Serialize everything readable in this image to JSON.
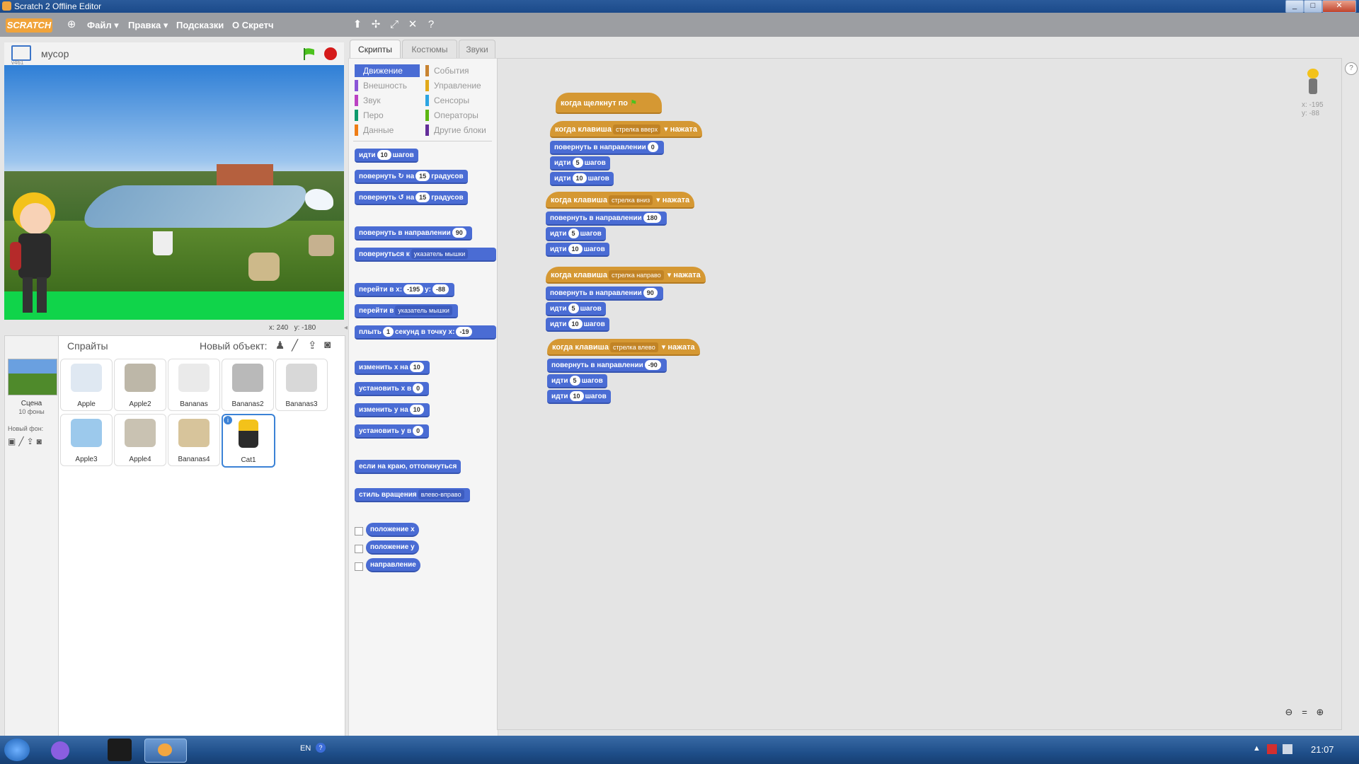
{
  "window": {
    "title": "Scratch 2 Offline Editor",
    "min": "_",
    "max": "□",
    "close": "✕"
  },
  "menubar": {
    "logo": "SCRATCH",
    "items": [
      "Файл ▾",
      "Правка ▾",
      "Подсказки",
      "О Скретч"
    ]
  },
  "stage": {
    "project_name": "мусор",
    "version": "v461",
    "coords": {
      "x_label": "x:",
      "x": "240",
      "y_label": "y:",
      "y": "-180"
    }
  },
  "sprites_pane": {
    "title": "Спрайты",
    "new_object": "Новый объект:",
    "scene_label": "Сцена",
    "scene_count": "10 фоны",
    "new_backdrop": "Новый фон:",
    "sprites": [
      "Apple",
      "Apple2",
      "Bananas",
      "Bananas2",
      "Bananas3",
      "Apple3",
      "Apple4",
      "Bananas4",
      "Cat1"
    ]
  },
  "tabs": [
    "Скрипты",
    "Костюмы",
    "Звуки"
  ],
  "categories": {
    "left": [
      "Движение",
      "Внешность",
      "Звук",
      "Перо",
      "Данные"
    ],
    "right": [
      "События",
      "Управление",
      "Сенсоры",
      "Операторы",
      "Другие блоки"
    ],
    "colors": {
      "Движение": "#4a6cd4",
      "Внешность": "#8a55d7",
      "Звук": "#bb42c3",
      "Перо": "#0e9a6c",
      "Данные": "#ee7d16",
      "События": "#c88330",
      "Управление": "#e1a91a",
      "Сенсоры": "#2ca5e2",
      "Операторы": "#5cb712",
      "Другие блоки": "#632d99"
    }
  },
  "palette": {
    "move": {
      "a": "идти",
      "n": "10",
      "b": "шагов"
    },
    "turn_right": {
      "a": "повернуть",
      "b": "на",
      "n": "15",
      "c": "градусов"
    },
    "turn_left": {
      "a": "повернуть",
      "b": "на",
      "n": "15",
      "c": "градусов"
    },
    "point_dir": {
      "a": "повернуть в направлении",
      "n": "90"
    },
    "point_towards": {
      "a": "повернуться к",
      "dd": "указатель мышки"
    },
    "goto_xy": {
      "a": "перейти в x:",
      "x": "-195",
      "b": "y:",
      "y": "-88"
    },
    "goto": {
      "a": "перейти в",
      "dd": "указатель мышки"
    },
    "glide": {
      "a": "плыть",
      "n": "1",
      "b": "секунд в точку x:",
      "x": "-19"
    },
    "change_x": {
      "a": "изменить х на",
      "n": "10"
    },
    "set_x": {
      "a": "установить х в",
      "n": "0"
    },
    "change_y": {
      "a": "изменить у на",
      "n": "10"
    },
    "set_y": {
      "a": "установить у в",
      "n": "0"
    },
    "bounce": "если на краю, оттолкнуться",
    "rotation_style": {
      "a": "стиль вращения",
      "dd": "влево-вправо"
    },
    "reporters": [
      "положение х",
      "положение у",
      "направление"
    ]
  },
  "scripts": {
    "flag_hat": "когда щелкнут по",
    "groups": [
      {
        "key": "стрелка вверх",
        "dir": "0",
        "s1": "5",
        "s2": "10"
      },
      {
        "key": "стрелка вниз",
        "dir": "180",
        "s1": "5",
        "s2": "10"
      },
      {
        "key": "стрелка направо",
        "dir": "90",
        "s1": "5",
        "s2": "10"
      },
      {
        "key": "стрелка влево",
        "dir": "-90",
        "s1": "5",
        "s2": "10"
      }
    ],
    "when_key": "когда клавиша",
    "pressed": "нажата",
    "turn_dir": "повернуть в направлении",
    "move": "идти",
    "steps": "шагов",
    "sprite_info": {
      "x": "x: -195",
      "y": "y: -88"
    }
  },
  "taskbar": {
    "lang": "EN",
    "time": "21:07"
  }
}
